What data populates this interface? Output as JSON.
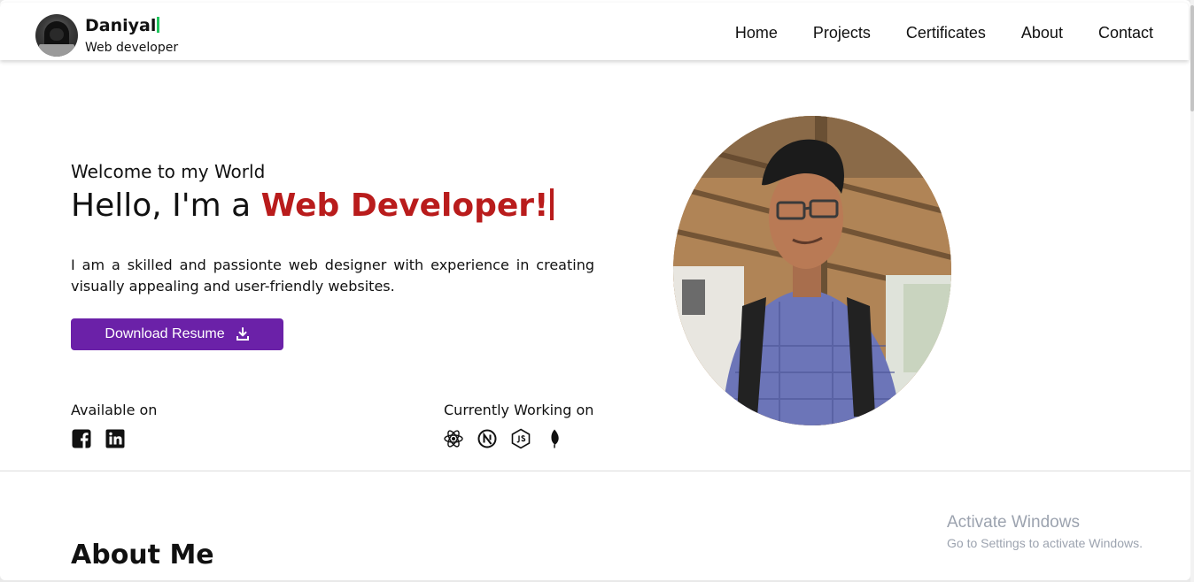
{
  "brand": {
    "name": "Daniyal",
    "subtitle": "Web developer"
  },
  "nav": {
    "items": [
      "Home",
      "Projects",
      "Certificates",
      "About",
      "Contact"
    ]
  },
  "hero": {
    "welcome": "Welcome to my World",
    "hello_prefix": "Hello, I'm a ",
    "hello_accent": "Web Developer!",
    "bio": "I am a skilled and passionte web designer with experience in creating visually appealing and user-friendly websites.",
    "button_label": "Download Resume",
    "available_label": "Available on",
    "working_label": "Currently Working on",
    "social_icons": [
      "facebook-icon",
      "linkedin-icon"
    ],
    "tech_icons": [
      "react-icon",
      "nextjs-icon",
      "nodejs-icon",
      "mongodb-icon"
    ]
  },
  "about": {
    "title": "About Me"
  },
  "watermark": {
    "title": "Activate Windows",
    "subtitle": "Go to Settings to activate Windows."
  },
  "colors": {
    "accent_red": "#b91c1c",
    "button_purple": "#6b21a8",
    "brand_cursor_green": "#22c55e"
  }
}
